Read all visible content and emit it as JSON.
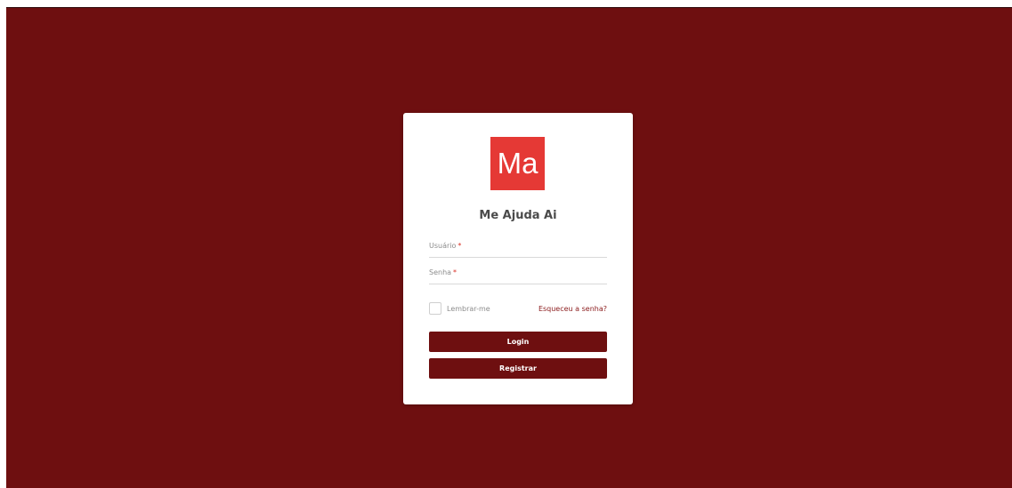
{
  "colors": {
    "background": "#6e0f10",
    "card": "#ffffff",
    "logo": "#e53935",
    "button": "#6e0f10",
    "link": "#8a1a1b",
    "required": "#d93025"
  },
  "logo": {
    "text": "Ma"
  },
  "app": {
    "title": "Me Ajuda Ai"
  },
  "form": {
    "username": {
      "label": "Usuário",
      "required_mark": "*",
      "value": ""
    },
    "password": {
      "label": "Senha",
      "required_mark": "*",
      "value": ""
    },
    "remember": {
      "label": "Lembrar-me",
      "checked": false
    },
    "forgot_link": "Esqueceu a senha?"
  },
  "buttons": {
    "login": "Login",
    "register": "Registrar"
  }
}
